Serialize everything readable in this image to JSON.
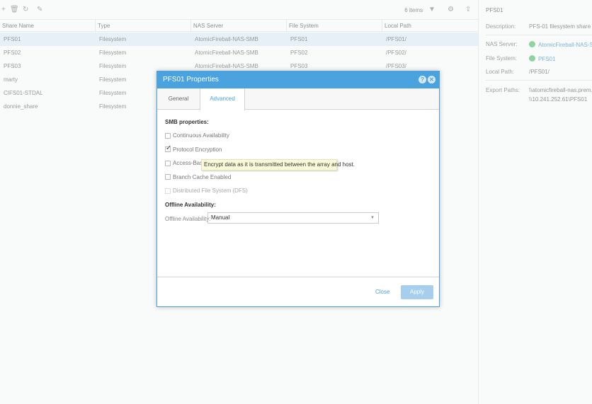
{
  "toolbar": {
    "icons": [
      "add-icon",
      "trash-icon",
      "refresh-icon",
      "edit-icon",
      "filter-icon",
      "gear-icon",
      "export-icon"
    ],
    "item_count": "6 items"
  },
  "grid": {
    "columns": [
      "Share Name",
      "Type",
      "NAS Server",
      "File System",
      "Local Path"
    ],
    "rows": [
      [
        "PFS01",
        "Filesystem",
        "AtomicFireball-NAS-SMB",
        "PFS01",
        "/PFS01/"
      ],
      [
        "PFS02",
        "Filesystem",
        "AtomicFireball-NAS-SMB",
        "PFS02",
        "/PFS02/"
      ],
      [
        "PFS03",
        "Filesystem",
        "AtomicFireball-NAS-SMB",
        "PFS03",
        "/PFS03/"
      ],
      [
        "marty",
        "Filesystem",
        "",
        "",
        ""
      ],
      [
        "CIFS01-STDAL",
        "Filesystem",
        "",
        "",
        ""
      ],
      [
        "donnie_share",
        "Filesystem",
        "",
        "",
        ""
      ]
    ]
  },
  "panel": {
    "title": "PFS01",
    "description_label": "Description:",
    "description": "PFS-01 filesystem share",
    "nas_label": "NAS Server:",
    "nas": "AtomicFireball-NAS-SMB",
    "fs_label": "File System:",
    "fs": "PFS01",
    "path_label": "Local Path:",
    "path": "/PFS01/",
    "export_label": "Export Paths:",
    "export1": "\\\\atomicfireball-nas.prem.nas",
    "export2": "\\\\10.241.252.61\\PFS01"
  },
  "dialog": {
    "title": "PFS01 Properties",
    "tabs": [
      "General",
      "Advanced"
    ],
    "active_tab": "Advanced",
    "smb_heading": "SMB properties:",
    "options": [
      {
        "label": "Continuous Availability",
        "checked": false
      },
      {
        "label": "Protocol Encryption",
        "checked": true
      },
      {
        "label": "Access-Base",
        "checked": false
      },
      {
        "label": "Branch Cache Enabled",
        "checked": false
      },
      {
        "label": "Distributed File System (DFS)",
        "checked": false,
        "disabled": true
      }
    ],
    "offline_heading": "Offline Availability:",
    "offline_label": "Offline Availability:",
    "offline_value": "Manual",
    "close": "Close",
    "apply": "Apply",
    "tooltip": "Encrypt data as it is transmitted between the array and host."
  },
  "colors": {
    "accent": "#4aa3df"
  }
}
